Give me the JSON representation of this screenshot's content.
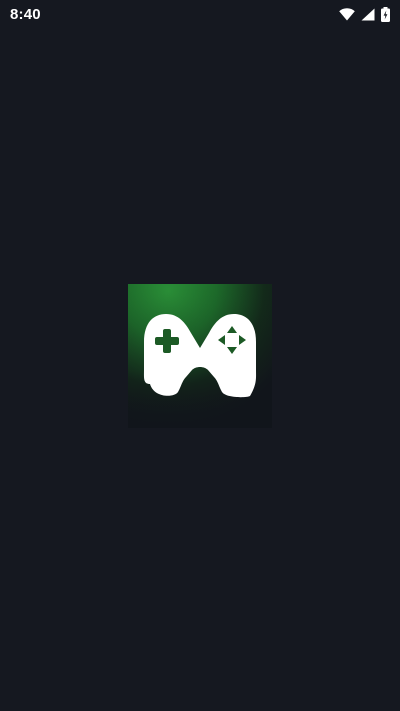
{
  "status_bar": {
    "time": "8:40",
    "icons": [
      "wifi-icon",
      "cellular-signal-icon",
      "battery-charging-icon"
    ]
  },
  "splash": {
    "logo": "gamepad-m-logo",
    "colors": {
      "background": "#151820",
      "logo_green": "#1f7a2e",
      "logo_dark": "#11151b",
      "glyph": "#ffffff"
    }
  }
}
